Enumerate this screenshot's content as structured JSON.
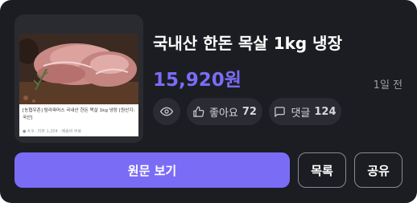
{
  "product": {
    "title": "국내산 한돈 목살 1kg 냉장",
    "price": "15,920원",
    "posted_ago": "1일 전"
  },
  "thumbnail": {
    "caption": "[농협우촌] 탐라파머스 국내산 한돈 목살 1kg 냉장 [원산지:국산]",
    "meta": "● 4.9 · 리뷰 1,204 · 배송비 무료"
  },
  "stats": {
    "like_label": "좋아요",
    "like_count": "72",
    "comment_label": "댓글",
    "comment_count": "124"
  },
  "actions": {
    "view_original": "원문 보기",
    "list": "목록",
    "share": "공유"
  },
  "colors": {
    "card_bg": "#1c1d22",
    "accent": "#7b6cf6",
    "pill_bg": "#2b2c33"
  },
  "icons": [
    "eye-icon",
    "thumbs-up-icon",
    "comment-icon"
  ]
}
